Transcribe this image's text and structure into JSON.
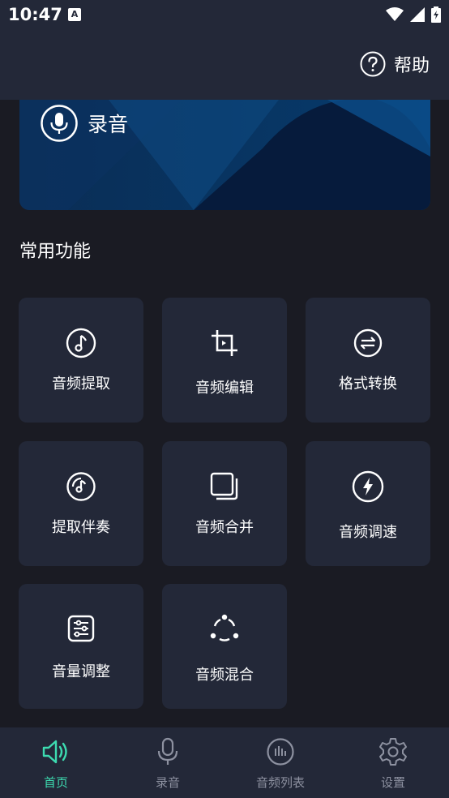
{
  "status_bar": {
    "time": "10:47",
    "notification_letter": "A"
  },
  "header": {
    "help_label": "帮助"
  },
  "banner": {
    "record_label": "录音"
  },
  "section": {
    "title": "常用功能"
  },
  "features": [
    {
      "label": "音频提取",
      "icon": "music-note-icon"
    },
    {
      "label": "音频编辑",
      "icon": "crop-icon"
    },
    {
      "label": "格式转换",
      "icon": "swap-arrows-icon"
    },
    {
      "label": "提取伴奏",
      "icon": "vinyl-icon"
    },
    {
      "label": "音频合并",
      "icon": "stacked-squares-icon"
    },
    {
      "label": "音频调速",
      "icon": "lightning-icon"
    },
    {
      "label": "音量调整",
      "icon": "sliders-icon"
    },
    {
      "label": "音频混合",
      "icon": "dots-circle-icon"
    }
  ],
  "bottom_nav": [
    {
      "label": "首页",
      "icon": "speaker-icon",
      "active": true
    },
    {
      "label": "录音",
      "icon": "microphone-icon",
      "active": false
    },
    {
      "label": "音频列表",
      "icon": "audio-bars-icon",
      "active": false
    },
    {
      "label": "设置",
      "icon": "gear-icon",
      "active": false
    }
  ],
  "colors": {
    "accent": "#3ddbb0",
    "card_bg": "#232838",
    "page_bg": "#1a1b23"
  }
}
